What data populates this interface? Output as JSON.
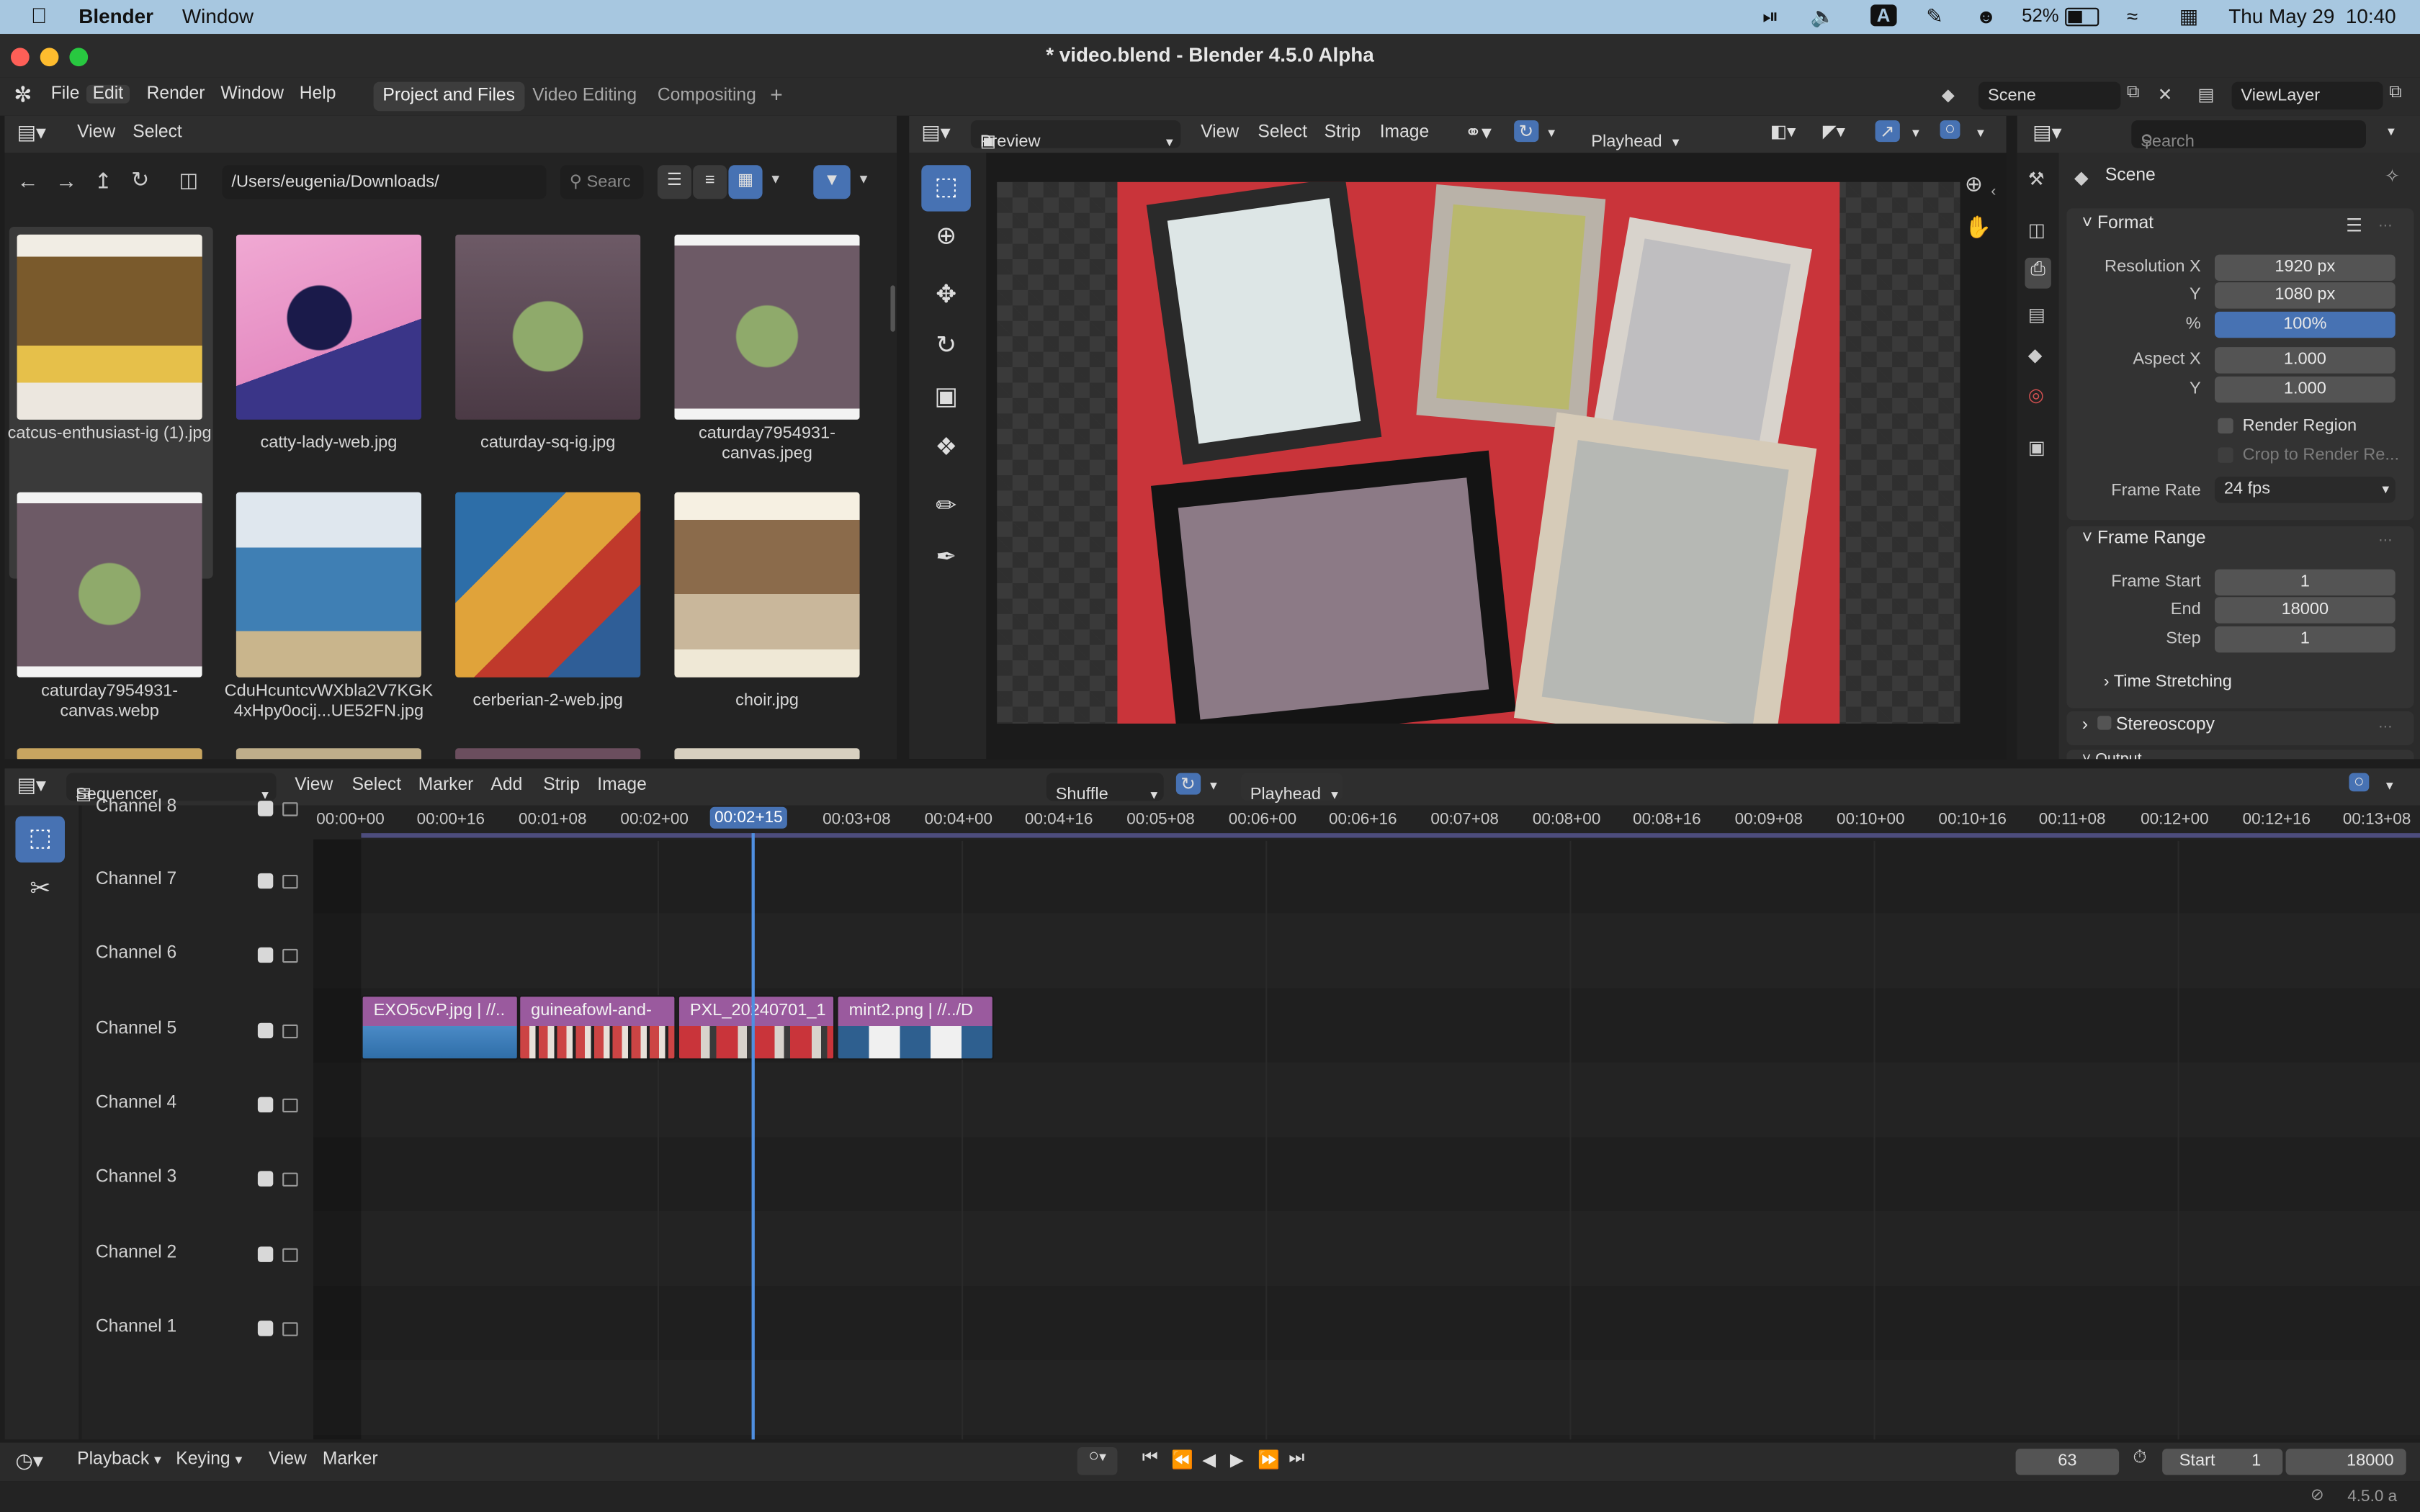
{
  "mac_menubar": {
    "app": "Blender",
    "menu": "Window",
    "battery": "52%",
    "input": "A",
    "datetime": "Thu May 29  10:40"
  },
  "window": {
    "title": "* video.blend - Blender 4.5.0 Alpha"
  },
  "topbar": {
    "menus": [
      "File",
      "Edit",
      "Render",
      "Window",
      "Help"
    ],
    "workspaces": [
      "Project and Files",
      "Video Editing",
      "Compositing"
    ],
    "active_workspace": "Project and Files",
    "scene": "Scene",
    "view_layer": "ViewLayer"
  },
  "file_browser": {
    "menus": [
      "View",
      "Select"
    ],
    "path": "/Users/eugenia/Downloads/",
    "search_placeholder": "Search",
    "files": [
      {
        "name": "catcus-enthusiast-ig (1).jpg",
        "selected": true
      },
      {
        "name": "catty-lady-web.jpg"
      },
      {
        "name": "caturday-sq-ig.jpg"
      },
      {
        "name": "caturday7954931-canvas.jpeg"
      },
      {
        "name": "caturday7954931-canvas.webp"
      },
      {
        "name": "CduHcuntcvWXbla2V7KGK4xHpy0ocij...UE52FN.jpg"
      },
      {
        "name": "cerberian-2-web.jpg"
      },
      {
        "name": "choir.jpg"
      }
    ]
  },
  "preview": {
    "mode": "Preview",
    "menus": [
      "View",
      "Select",
      "Strip",
      "Image"
    ],
    "playhead": "Playhead"
  },
  "properties": {
    "search_placeholder": "Search",
    "context": "Scene",
    "format": {
      "title": "Format",
      "resolution_x_label": "Resolution X",
      "resolution_x": "1920 px",
      "y_label": "Y",
      "resolution_y": "1080 px",
      "percent_label": "%",
      "percent": "100%",
      "aspect_x_label": "Aspect X",
      "aspect_x": "1.000",
      "aspect_y_label": "Y",
      "aspect_y": "1.000",
      "render_region": "Render Region",
      "crop": "Crop to Render Re...",
      "frame_rate_label": "Frame Rate",
      "frame_rate": "24 fps"
    },
    "frame_range": {
      "title": "Frame Range",
      "start_label": "Frame Start",
      "start": "1",
      "end_label": "End",
      "end": "18000",
      "step_label": "Step",
      "step": "1"
    },
    "time_stretching": "Time Stretching",
    "stereoscopy": "Stereoscopy",
    "output": "Output"
  },
  "sequencer": {
    "editor": "Sequencer",
    "menus": [
      "View",
      "Select",
      "Marker",
      "Add",
      "Strip",
      "Image"
    ],
    "shuffle": "Shuffle",
    "playhead": "Playhead",
    "channels": [
      "Channel 8",
      "Channel 7",
      "Channel 6",
      "Channel 5",
      "Channel 4",
      "Channel 3",
      "Channel 2",
      "Channel 1"
    ],
    "ticks": [
      "00:00+00",
      "00:00+16",
      "00:01+08",
      "00:02+00",
      "00:02+15",
      "00:03+08",
      "00:04+00",
      "00:04+16",
      "00:05+08",
      "00:06+00",
      "00:06+16",
      "00:07+08",
      "00:08+00",
      "00:08+16",
      "00:09+08",
      "00:10+00",
      "00:10+16",
      "00:11+08",
      "00:12+00",
      "00:12+16",
      "00:13+08"
    ],
    "current_time": "00:02+15",
    "strips": [
      {
        "label": "EXO5cvP.jpg | //..",
        "color": "#9a5a9e"
      },
      {
        "label": "guineafowl-and-",
        "color": "#9a5a9e"
      },
      {
        "label": "PXL_20240701_1",
        "color": "#9a5a9e"
      },
      {
        "label": "mint2.png | //../D",
        "color": "#9a5a9e"
      }
    ]
  },
  "timeline": {
    "menus": [
      "Playback",
      "Keying",
      "View",
      "Marker"
    ],
    "current_frame": "63",
    "start_label": "Start",
    "start": "1",
    "end": "18000"
  },
  "statusbar": {
    "version": "4.5.0 a"
  },
  "colors": {
    "accent": "#4772b3",
    "strip": "#9a5a9e",
    "playhead": "#4f8fe0"
  }
}
